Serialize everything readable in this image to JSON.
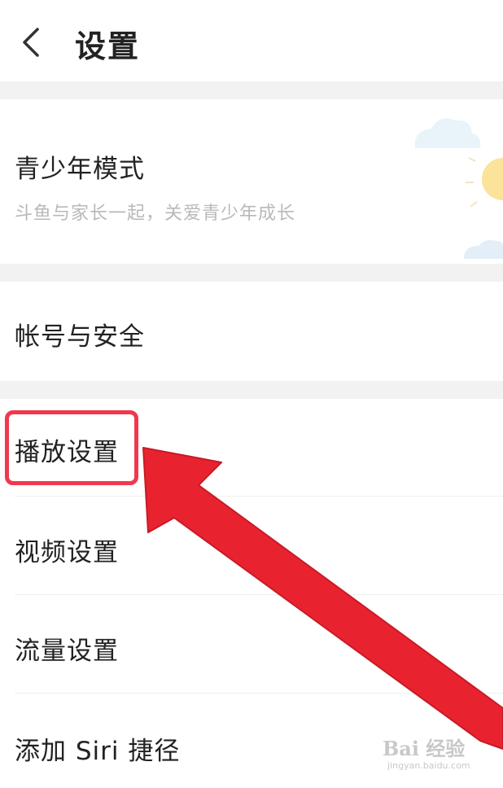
{
  "header": {
    "title": "设置",
    "back_icon": "chevron-left-icon"
  },
  "youth_mode": {
    "title": "青少年模式",
    "subtitle": "斗鱼与家长一起，关爱青少年成长",
    "illustration_icon": "cloud-sun-icon"
  },
  "rows": {
    "account": "帐号与安全",
    "playback": "播放设置",
    "video": "视频设置",
    "traffic": "流量设置",
    "siri": "添加 Siri 捷径"
  },
  "annotation": {
    "highlight_color": "#f0384e",
    "arrow_color": "#e8232f"
  },
  "watermark": {
    "logo": "Bai 经验",
    "sub": "jingyan.baidu.com"
  }
}
